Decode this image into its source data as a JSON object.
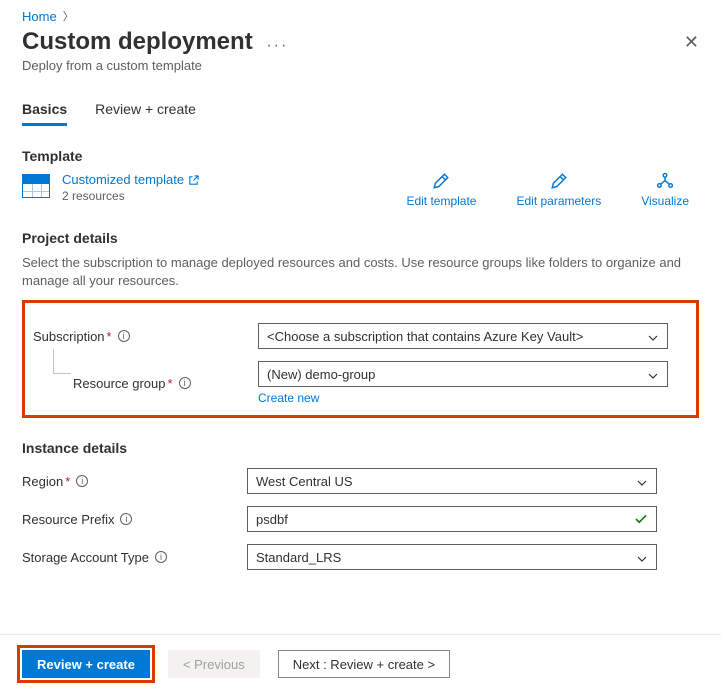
{
  "breadcrumb": {
    "home": "Home"
  },
  "title": "Custom deployment",
  "subtitle": "Deploy from a custom template",
  "tabs": {
    "basics": "Basics",
    "review": "Review + create"
  },
  "template": {
    "heading": "Template",
    "link": "Customized template",
    "resource_count": "2 resources",
    "actions": {
      "edit_template": "Edit template",
      "edit_parameters": "Edit parameters",
      "visualize": "Visualize"
    }
  },
  "project_details": {
    "heading": "Project details",
    "description": "Select the subscription to manage deployed resources and costs. Use resource groups like folders to organize and manage all your resources.",
    "subscription_label": "Subscription",
    "subscription_value": "<Choose a subscription that contains Azure Key Vault>",
    "resource_group_label": "Resource group",
    "resource_group_value": "(New) demo-group",
    "create_new": "Create new"
  },
  "instance_details": {
    "heading": "Instance details",
    "region_label": "Region",
    "region_value": "West Central US",
    "prefix_label": "Resource Prefix",
    "prefix_value": "psdbf",
    "storage_label": "Storage Account Type",
    "storage_value": "Standard_LRS"
  },
  "footer": {
    "review_create": "Review + create",
    "previous": "< Previous",
    "next": "Next : Review + create >"
  }
}
